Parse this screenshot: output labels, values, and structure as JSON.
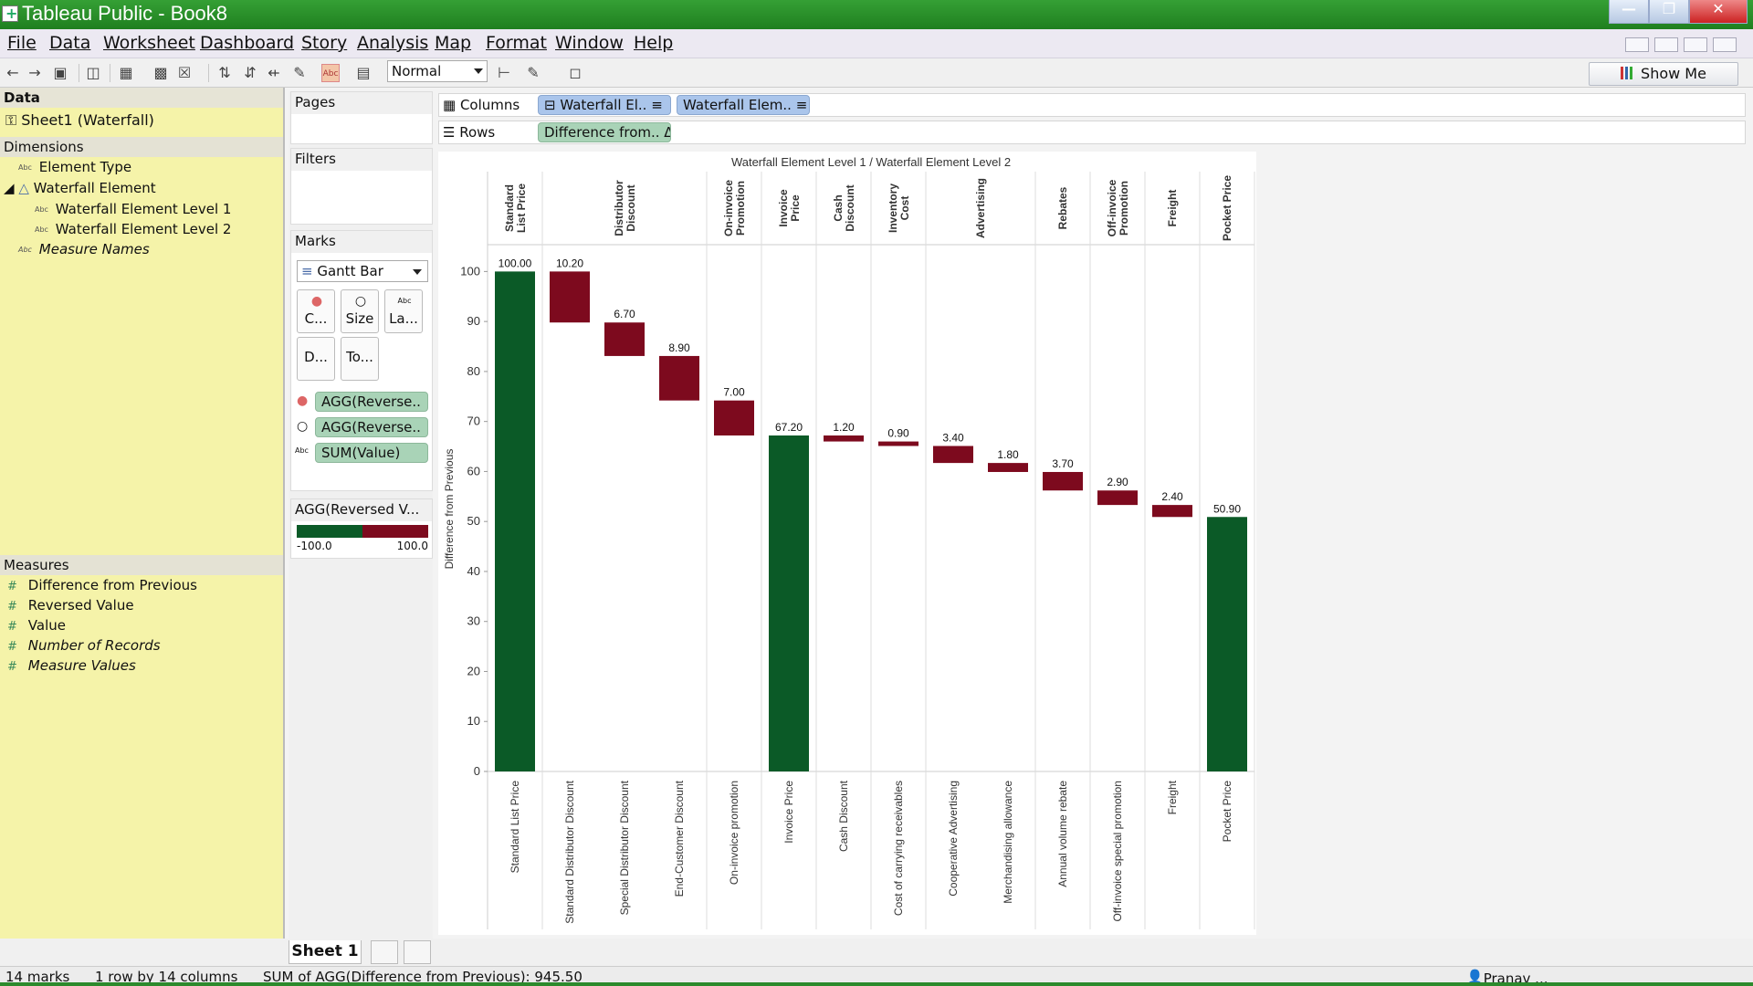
{
  "window": {
    "title": "Tableau Public - Book8"
  },
  "menu": [
    "File",
    "Data",
    "Worksheet",
    "Dashboard",
    "Story",
    "Analysis",
    "Map",
    "Format",
    "Window",
    "Help"
  ],
  "toolbar": {
    "fit": "Normal",
    "show_me": "Show Me"
  },
  "data_pane": {
    "header": "Data",
    "source": "Sheet1 (Waterfall)",
    "dimensions_header": "Dimensions",
    "dimensions": [
      "Element Type",
      "Waterfall Element",
      "Waterfall Element Level 1",
      "Waterfall Element Level 2",
      "Measure Names"
    ],
    "measures_header": "Measures",
    "measures": [
      "Difference from Previous",
      "Reversed Value",
      "Value",
      "Number of Records",
      "Measure Values"
    ]
  },
  "pages": "Pages",
  "filters": "Filters",
  "marks": {
    "header": "Marks",
    "type": "Gantt Bar",
    "buttons": [
      "C...",
      "Size",
      "La...",
      "D...",
      "To..."
    ],
    "pills": [
      "AGG(Reverse..",
      "AGG(Reverse..",
      "SUM(Value)"
    ]
  },
  "legend": {
    "title": "AGG(Reversed V...",
    "min": "-100.0",
    "max": "100.0",
    "neg_color": "#0b5a27",
    "pos_color": "#7d0a1e"
  },
  "shelves": {
    "columns_label": "Columns",
    "rows_label": "Rows",
    "columns": [
      "Waterfall El..",
      "Waterfall Elem.."
    ],
    "rows": [
      "Difference from.. Δ"
    ]
  },
  "sheet_tab": "Sheet 1",
  "status": {
    "marks": "14 marks",
    "dims": "1 row by 14 columns",
    "sum": "SUM of AGG(Difference from Previous): 945.50",
    "user": "Pranav ..."
  },
  "chart_data": {
    "type": "bar",
    "title": "Waterfall Element Level 1  /  Waterfall Element Level 2",
    "ylabel": "Difference from Previous",
    "ylim": [
      0,
      105
    ],
    "yticks": [
      "0",
      "10",
      "20",
      "30",
      "40",
      "50",
      "60",
      "70",
      "80",
      "90",
      "100"
    ],
    "groups": [
      {
        "label": "Standard\nList Price",
        "span": 1
      },
      {
        "label": "Distributor\nDiscount",
        "span": 3
      },
      {
        "label": "On-invoice\nPromotion",
        "span": 1
      },
      {
        "label": "Invoice\nPrice",
        "span": 1
      },
      {
        "label": "Cash\nDiscount",
        "span": 1
      },
      {
        "label": "Inventory\nCost",
        "span": 1
      },
      {
        "label": "Advertising",
        "span": 2
      },
      {
        "label": "Rebates",
        "span": 1
      },
      {
        "label": "Off-invoice\nPromotion",
        "span": 1
      },
      {
        "label": "Freight",
        "span": 1
      },
      {
        "label": "Pocket Price",
        "span": 1
      }
    ],
    "categories": [
      "Standard List Price",
      "Standard Distributor Discount",
      "Special Distributor Discount",
      "End-Customer Discount",
      "On-invoice promotion",
      "Invoice Price",
      "Cash Discount",
      "Cost of carrying receivables",
      "Cooperative Advertising",
      "Merchandising allowance",
      "Annual volume rebate",
      "Off-invoice special promotion",
      "Freight",
      "Pocket Price"
    ],
    "bars": [
      {
        "start": 0,
        "end": 100.0,
        "label": "100.00",
        "kind": "total"
      },
      {
        "start": 100.0,
        "end": 89.8,
        "label": "10.20",
        "kind": "decrease"
      },
      {
        "start": 89.8,
        "end": 83.1,
        "label": "6.70",
        "kind": "decrease"
      },
      {
        "start": 83.1,
        "end": 74.2,
        "label": "8.90",
        "kind": "decrease"
      },
      {
        "start": 74.2,
        "end": 67.2,
        "label": "7.00",
        "kind": "decrease"
      },
      {
        "start": 0,
        "end": 67.2,
        "label": "67.20",
        "kind": "total"
      },
      {
        "start": 67.2,
        "end": 66.0,
        "label": "1.20",
        "kind": "decrease"
      },
      {
        "start": 66.0,
        "end": 65.1,
        "label": "0.90",
        "kind": "decrease"
      },
      {
        "start": 65.1,
        "end": 61.7,
        "label": "3.40",
        "kind": "decrease"
      },
      {
        "start": 61.7,
        "end": 59.9,
        "label": "1.80",
        "kind": "decrease"
      },
      {
        "start": 59.9,
        "end": 56.2,
        "label": "3.70",
        "kind": "decrease"
      },
      {
        "start": 56.2,
        "end": 53.3,
        "label": "2.90",
        "kind": "decrease"
      },
      {
        "start": 53.3,
        "end": 50.9,
        "label": "2.40",
        "kind": "decrease"
      },
      {
        "start": 0,
        "end": 50.9,
        "label": "50.90",
        "kind": "total"
      }
    ],
    "colors": {
      "total": "#0b5a27",
      "decrease": "#7d0a1e"
    },
    "grid": false
  }
}
